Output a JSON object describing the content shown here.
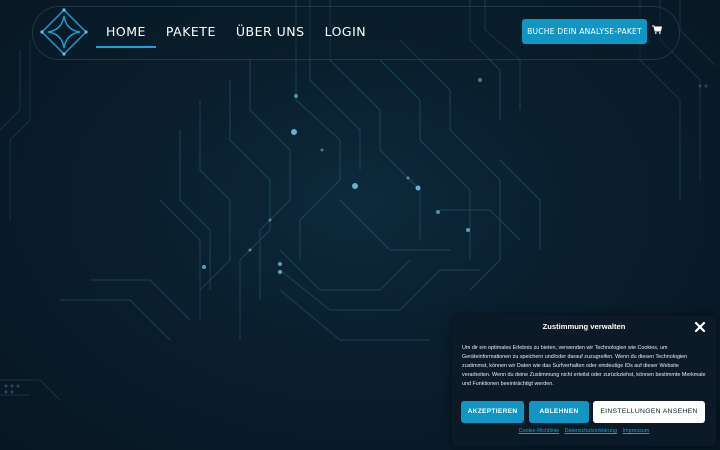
{
  "nav": {
    "items": [
      {
        "label": "HOME",
        "active": true
      },
      {
        "label": "PAKETE",
        "active": false
      },
      {
        "label": "ÜBER UNS",
        "active": false
      },
      {
        "label": "LOGIN",
        "active": false
      }
    ],
    "cta_label": "BUCHE DEIN ANALYSE-PAKET",
    "cart_icon": "cart-icon",
    "logo_icon": "logo-diamond-icon"
  },
  "cookie": {
    "title": "Zustimmung verwalten",
    "text": "Um dir ein optimales Erlebnis zu bieten, verwenden wir Technologien wie Cookies, um Geräteinformationen zu speichern und/oder darauf zuzugreifen. Wenn du diesen Technologien zustimmst, können wir Daten wie das Surfverhalten oder eindeutige IDs auf dieser Website verarbeiten. Wenn du deine Zustimmung nicht erteilst oder zurückziehst, können bestimmte Merkmale und Funktionen beeinträchtigt werden.",
    "accept_label": "AKZEPTIEREN",
    "deny_label": "ABLEHNEN",
    "settings_label": "EINSTELLUNGEN ANSEHEN",
    "links": [
      "Cookie-Richtlinie",
      "Datenschutzerklärung",
      "Impressum"
    ],
    "close_icon": "close-icon"
  },
  "colors": {
    "accent": "#1196c4",
    "background": "#0a1f2e",
    "dialog": "#0b1a26"
  }
}
